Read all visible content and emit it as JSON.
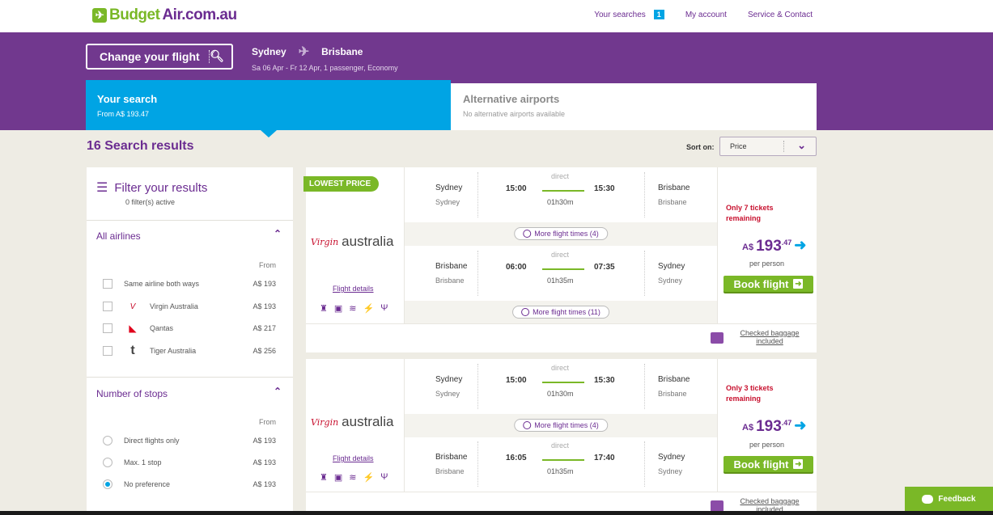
{
  "brand": {
    "name_part1": "Budget",
    "name_part2": "Air.com.au"
  },
  "topnav": {
    "your_searches": "Your searches",
    "searches_count": "1",
    "my_account": "My account",
    "service": "Service & Contact"
  },
  "search": {
    "change_label": "Change your flight",
    "origin": "Sydney",
    "destination": "Brisbane",
    "details": "Sa 06 Apr - Fr 12 Apr, 1 passenger, Economy"
  },
  "tabs": {
    "your_search": {
      "title": "Your search",
      "subtitle": "From A$ 193.47"
    },
    "alternative": {
      "title": "Alternative airports",
      "subtitle": "No alternative airports available"
    }
  },
  "results": {
    "count_label": "16 Search results",
    "sort_label": "Sort on:",
    "sort_value": "Price"
  },
  "filter": {
    "title": "Filter your results",
    "active": "0 filter(s) active",
    "airlines": {
      "title": "All airlines",
      "from": "From",
      "items": [
        {
          "label": "Same airline both ways",
          "price": "A$ 193",
          "logo": ""
        },
        {
          "label": "Virgin Australia",
          "price": "A$ 193",
          "logo": "virgin-logo"
        },
        {
          "label": "Qantas",
          "price": "A$ 217",
          "logo": "qantas-logo"
        },
        {
          "label": "Tiger Australia",
          "price": "A$ 256",
          "logo": "tiger-logo"
        }
      ]
    },
    "stops": {
      "title": "Number of stops",
      "from": "From",
      "items": [
        {
          "label": "Direct flights only",
          "price": "A$ 193",
          "selected": false
        },
        {
          "label": "Max. 1 stop",
          "price": "A$ 193",
          "selected": false
        },
        {
          "label": "No preference",
          "price": "A$ 193",
          "selected": true
        }
      ]
    }
  },
  "cards": [
    {
      "badge": "LOWEST PRICE",
      "airline": "australia",
      "airline_mark": "Virgin",
      "details_link": "Flight details",
      "outbound": {
        "from": "Sydney",
        "from_sub": "Sydney",
        "dep": "15:00",
        "arr": "15:30",
        "type": "direct",
        "duration": "01h30m",
        "to": "Brisbane",
        "to_sub": "Brisbane"
      },
      "outbound_more": "More flight times (4)",
      "inbound": {
        "from": "Brisbane",
        "from_sub": "Brisbane",
        "dep": "06:00",
        "arr": "07:35",
        "type": "direct",
        "duration": "01h35m",
        "to": "Sydney",
        "to_sub": "Sydney"
      },
      "inbound_more": "More flight times (11)",
      "remaining": "Only 7 tickets remaining",
      "currency": "A$",
      "price_int": "193",
      "price_cents": ".47",
      "per_person": "per person",
      "book": "Book flight",
      "baggage": "Checked baggage included"
    },
    {
      "airline": "australia",
      "airline_mark": "Virgin",
      "details_link": "Flight details",
      "outbound": {
        "from": "Sydney",
        "from_sub": "Sydney",
        "dep": "15:00",
        "arr": "15:30",
        "type": "direct",
        "duration": "01h30m",
        "to": "Brisbane",
        "to_sub": "Brisbane"
      },
      "outbound_more": "More flight times (4)",
      "inbound": {
        "from": "Brisbane",
        "from_sub": "Brisbane",
        "dep": "16:05",
        "arr": "17:40",
        "type": "direct",
        "duration": "01h35m",
        "to": "Sydney",
        "to_sub": "Sydney"
      },
      "remaining": "Only 3 tickets remaining",
      "currency": "A$",
      "price_int": "193",
      "price_cents": ".47",
      "per_person": "per person",
      "book": "Book flight",
      "baggage": "Checked baggage included"
    }
  ],
  "feedback": "Feedback",
  "colors": {
    "purple": "#71388e",
    "blue": "#00a4e4",
    "green": "#7ab827",
    "red": "#c8102e"
  }
}
